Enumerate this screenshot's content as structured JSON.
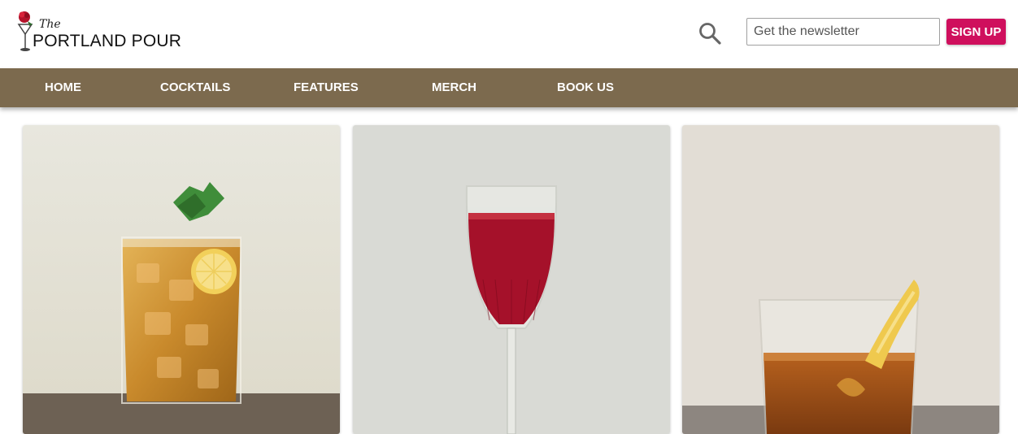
{
  "brand": {
    "the": "The",
    "name": "PORTLAND POUR"
  },
  "search": {
    "placeholder": "Get the newsletter",
    "value": ""
  },
  "signup": {
    "label": "SIGN UP"
  },
  "nav": {
    "items": [
      {
        "label": "HOME"
      },
      {
        "label": "COCKTAILS"
      },
      {
        "label": "FEATURES"
      },
      {
        "label": "MERCH"
      },
      {
        "label": "BOOK US"
      }
    ]
  },
  "cards": [
    {
      "image": "iced tea highball with mint and lemon"
    },
    {
      "image": "red sparkling cocktail in flute"
    },
    {
      "image": "old fashioned with orange peel"
    }
  ],
  "colors": {
    "nav_bg": "#7c6a4e",
    "accent": "#cf0f5d",
    "header_bg": "#ffffff"
  }
}
